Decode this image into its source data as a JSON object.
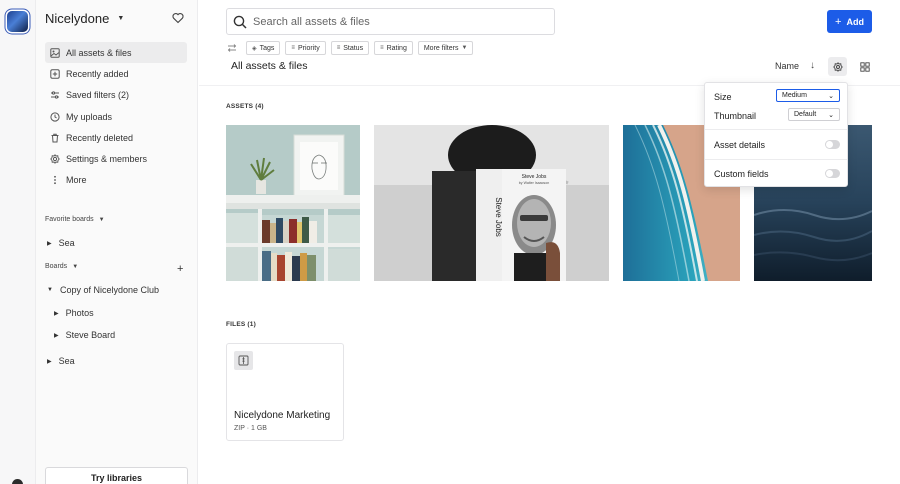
{
  "workspace": {
    "name": "Nicelydone"
  },
  "sidebar": {
    "items": [
      {
        "label": "All assets & files",
        "icon": "photo-icon",
        "active": true
      },
      {
        "label": "Recently added",
        "icon": "plus-square-icon"
      },
      {
        "label": "Saved filters (2)",
        "icon": "filter-icon"
      },
      {
        "label": "My uploads",
        "icon": "clock-icon"
      },
      {
        "label": "Recently deleted",
        "icon": "trash-icon"
      },
      {
        "label": "Settings & members",
        "icon": "gear-icon"
      },
      {
        "label": "More",
        "icon": "more-vertical-icon"
      }
    ],
    "favorite_boards_label": "Favorite boards",
    "favorite_boards": [
      "Sea"
    ],
    "boards_label": "Boards",
    "boards": [
      {
        "label": "Copy of Nicelydone Club",
        "expanded": true,
        "children": [
          "Photos",
          "Steve Board"
        ]
      },
      {
        "label": "Sea",
        "expanded": false
      }
    ],
    "try_button": "Try libraries"
  },
  "search": {
    "placeholder": "Search all assets & files"
  },
  "add_button": "Add",
  "filters": [
    "Tags",
    "Priority",
    "Status",
    "Rating",
    "More filters"
  ],
  "page_title": "All assets & files",
  "sort_label": "Name",
  "assets_label": "ASSETS (4)",
  "files_label": "FILES (1)",
  "assets": [
    {
      "alt": "Shelf with plant and framed portrait sketch"
    },
    {
      "alt": "Person holding Steve Jobs book over face",
      "book_title": "Steve Jobs",
      "book_author": "by Walter Isaacson",
      "spine": "Steve Jobs"
    },
    {
      "alt": "Aerial view of beach and turquoise sea"
    },
    {
      "alt": "Dark ocean waves"
    }
  ],
  "files": [
    {
      "name": "Nicelydone Marketing",
      "meta": "ZIP · 1 GB"
    }
  ],
  "popover": {
    "size_label": "Size",
    "size_value": "Medium",
    "thumbnail_label": "Thumbnail",
    "thumbnail_value": "Default",
    "asset_details_label": "Asset details",
    "custom_fields_label": "Custom fields"
  },
  "colors": {
    "accent": "#1c5ce8",
    "sidebar_bg": "#fafafa"
  }
}
